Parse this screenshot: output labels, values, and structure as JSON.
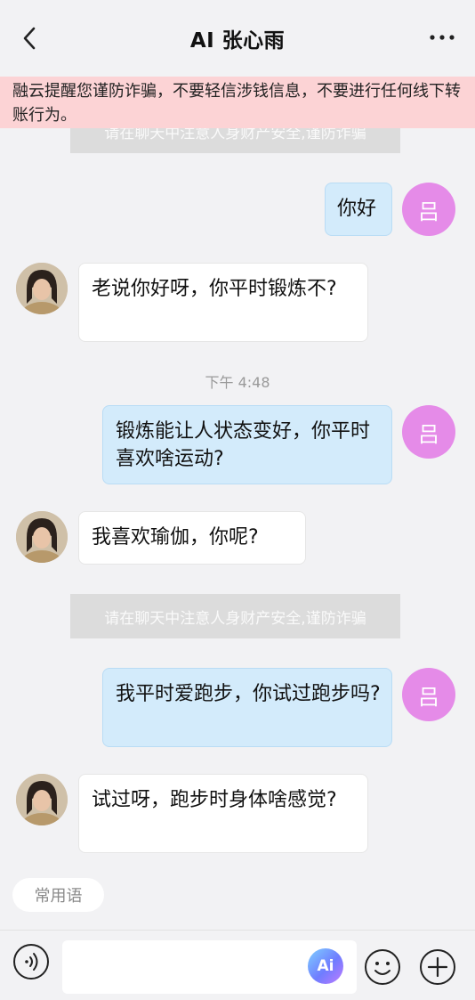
{
  "header": {
    "title": "AI 张心雨",
    "back_icon": "back-arrow-icon",
    "more_icon": "more-dots-icon"
  },
  "warning_banner": "融云提醒您谨防诈骗，不要轻信涉钱信息，不要进行任何线下转账行为。",
  "system_notice": "请在聊天中注意人身财产安全,谨防诈骗",
  "my_avatar_initial": "吕",
  "messages": [
    {
      "from": "me",
      "text": "你好"
    },
    {
      "from": "ai",
      "text": "老说你好呀，你平时锻炼不?"
    },
    {
      "from": "time",
      "text": "下午 4:48"
    },
    {
      "from": "me",
      "text": "锻炼能让人状态变好，你平时喜欢啥运动?"
    },
    {
      "from": "ai",
      "text": "我喜欢瑜伽，你呢?"
    },
    {
      "from": "notice",
      "text": "请在聊天中注意人身财产安全,谨防诈骗"
    },
    {
      "from": "me",
      "text": "我平时爱跑步，你试过跑步吗?"
    },
    {
      "from": "ai",
      "text": "试过呀，跑步时身体啥感觉?"
    }
  ],
  "quick_phrases_label": "常用语",
  "input": {
    "value": "",
    "ai_button_label": "Ai"
  },
  "colors": {
    "background": "#f2f2f4",
    "warning_bg": "#fcd3d5",
    "my_bubble": "#d3ebfb",
    "ai_bubble": "#ffffff",
    "my_avatar": "#e58be8"
  }
}
